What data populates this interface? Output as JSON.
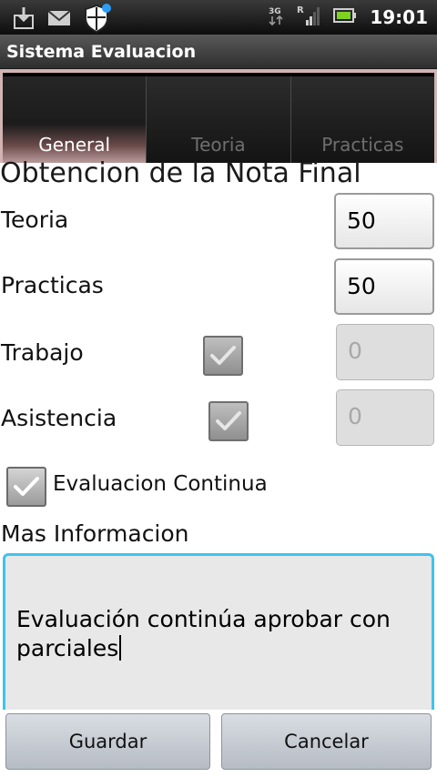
{
  "status_bar": {
    "network": "3G",
    "roaming": "R",
    "time": "19:01"
  },
  "app": {
    "title": "Sistema Evaluacion"
  },
  "tabs": [
    {
      "label": "General",
      "selected": true
    },
    {
      "label": "Teoria",
      "selected": false
    },
    {
      "label": "Practicas",
      "selected": false
    }
  ],
  "form": {
    "heading": "Obtencion de la Nota Final",
    "teoria": {
      "label": "Teoria",
      "value": "50"
    },
    "practicas": {
      "label": "Practicas",
      "value": "50"
    },
    "trabajo": {
      "label": "Trabajo",
      "value": "0",
      "checked": true,
      "enabled": false
    },
    "asistencia": {
      "label": "Asistencia",
      "value": "0",
      "checked": true,
      "enabled": false
    },
    "evaluacion_continua": {
      "label": "Evaluacion Continua",
      "checked": true
    },
    "info": {
      "label": "Mas Informacion",
      "text": "Evaluación continúa aprobar con parciales"
    }
  },
  "buttons": {
    "save": "Guardar",
    "cancel": "Cancelar"
  },
  "colors": {
    "focus_border": "#3ec3ee",
    "tab_highlight": "#d2b4b4"
  }
}
